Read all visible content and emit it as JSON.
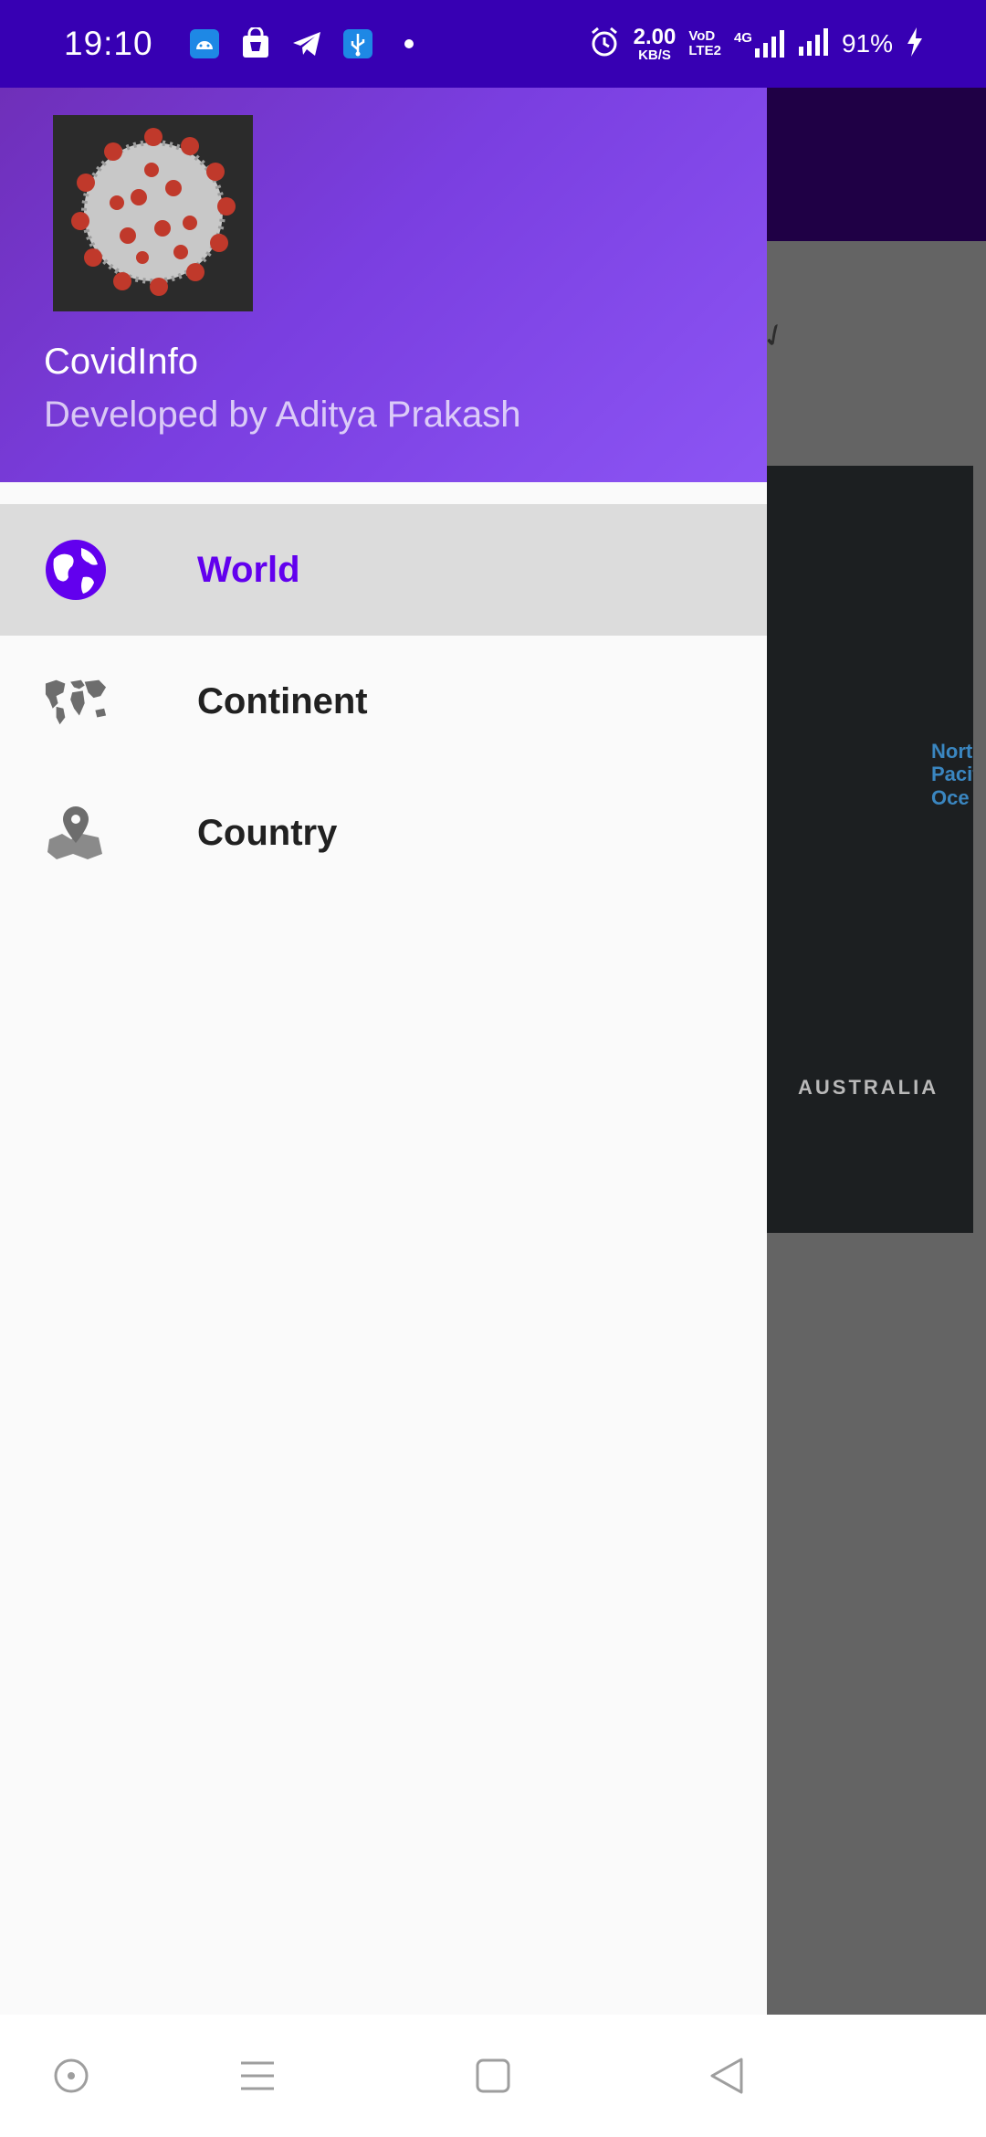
{
  "status_bar": {
    "time": "19:10",
    "notification_icons": [
      "android-icon",
      "shopping-bag-icon",
      "telegram-icon",
      "usb-icon",
      "dot-icon"
    ],
    "alarm_icon": "alarm-icon",
    "net_speed_value": "2.00",
    "net_speed_unit": "KB/S",
    "volte_top": "VoD",
    "volte_bottom": "LTE2",
    "network_type": "4G",
    "battery": "91%",
    "colors": {
      "background": "#3700b3"
    }
  },
  "drawer": {
    "header": {
      "image": "coronavirus-image",
      "title": "CovidInfo",
      "subtitle": "Developed by Aditya Prakash",
      "gradient": [
        "#6f2fb9",
        "#8c55f4"
      ]
    },
    "items": [
      {
        "label": "World",
        "icon": "globe-icon",
        "selected": true
      },
      {
        "label": "Continent",
        "icon": "world-map-icon",
        "selected": false
      },
      {
        "label": "Country",
        "icon": "map-pin-icon",
        "selected": false
      }
    ],
    "accent_color": "#6200ee"
  },
  "background_app": {
    "map_labels": {
      "ocean": "North Pacific Ocean",
      "ocean_line1": "Nort",
      "ocean_line2": "Pacif",
      "ocean_line3": "Oce",
      "australia": "AUSTRALIA"
    }
  },
  "nav_bar": {
    "buttons": [
      "assistant-icon",
      "menu-icon",
      "home-icon",
      "back-icon"
    ]
  }
}
